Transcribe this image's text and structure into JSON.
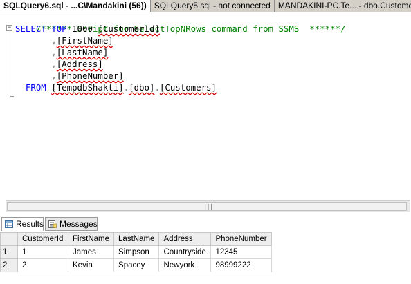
{
  "tabs": [
    {
      "label": "SQLQuery6.sql - ...C\\Mandakini (56))"
    },
    {
      "label": "SQLQuery5.sql - not connected"
    },
    {
      "label": "MANDAKINI-PC.Te... - dbo.Custome"
    }
  ],
  "editor": {
    "comment": "/****** Script for SelectTopNRows command from SSMS  ******/",
    "select_kw": "SELECT",
    "top_kw": "TOP",
    "top_n": "1000",
    "columns": [
      "[CustomerId]",
      "[FirstName]",
      "[LastName]",
      "[Address]",
      "[PhoneNumber]"
    ],
    "from_kw": "FROM",
    "table": [
      "[TempdbShakti]",
      "[dbo]",
      "[Customers]"
    ],
    "collapse_symbol": "−"
  },
  "results": {
    "tabs": [
      {
        "label": "Results",
        "icon": "grid-icon"
      },
      {
        "label": "Messages",
        "icon": "messages-icon"
      }
    ],
    "headers": [
      "CustomerId",
      "FirstName",
      "LastName",
      "Address",
      "PhoneNumber"
    ],
    "rows": [
      {
        "num": "1",
        "cells": [
          "1",
          "James",
          "Simpson",
          "Countryside",
          "12345"
        ]
      },
      {
        "num": "2",
        "cells": [
          "2",
          "Kevin",
          "Spacey",
          "Newyork",
          "98999222"
        ]
      }
    ]
  },
  "scrollbar": {
    "grip": "|||"
  }
}
